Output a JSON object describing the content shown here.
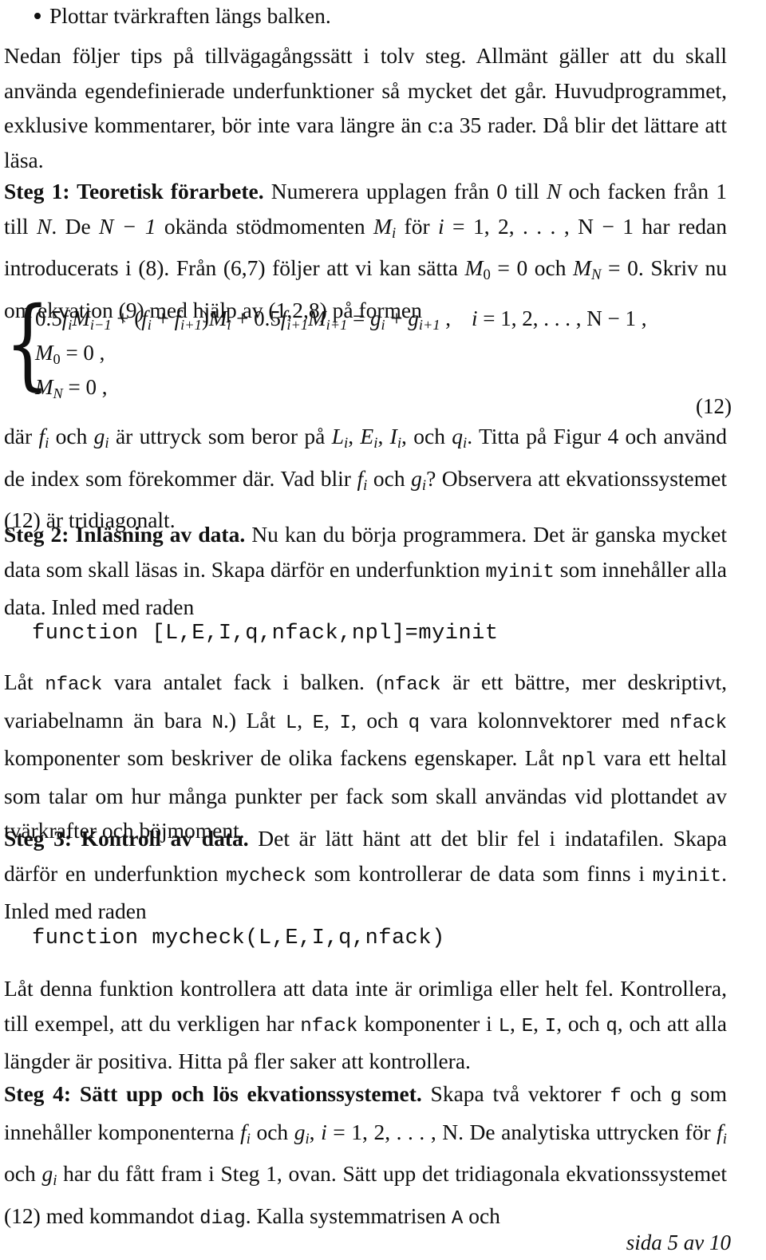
{
  "document": {
    "language": "sv",
    "footer": "sida 5 av 10"
  },
  "bullet": {
    "marker": "•",
    "text": "Plottar tvärkraften längs balken."
  },
  "intro": {
    "text": "Nedan följer tips på tillvägagångssätt i tolv steg. Allmänt gäller att du skall använda egendefinierade underfunktioner så mycket det går. Huvudprogrammet, exklusive kommentarer, bör inte vara längre än c:a 35 rader. Då blir det lättare att läsa."
  },
  "steg1": {
    "heading": "Steg 1: Teoretisk förarbete.",
    "body_part1": " Numerera upplagen från 0 till ",
    "sym_N": "N",
    "body_part2": " och facken från 1 till ",
    "body_part3": ". De ",
    "expr_N_minus_1": "N − 1",
    "body_part4": " okända stödmomenten ",
    "sym_M": "M",
    "sub_i": "i",
    "body_part5": " för ",
    "sym_i": "i",
    "expr_eq_list": " = 1, 2, . . . , N − 1",
    "body_part6": " har redan introducerats i (8). Från (6,7) följer att vi kan sätta ",
    "expr_M0": "M",
    "sub_0": "0",
    "expr_eq0": " = 0",
    "body_part7": " och ",
    "sub_N": "N",
    "body_part8": ". Skriv nu om ekvation (9) med hjälp av (1,2,8) på formen"
  },
  "equation12": {
    "tag": "(12)",
    "brace": "{",
    "line1": {
      "coef1": "0.5",
      "f1": "f",
      "f1sub": "i",
      "M1": "M",
      "M1sub": "i−1",
      "plus1": " + (",
      "f2": "f",
      "f2sub": "i",
      "plus2": " + ",
      "f3": "f",
      "f3sub": "i+1",
      "close": ")",
      "M2": "M",
      "M2sub": "i",
      "plus3": " + ",
      "coef2": "0.5",
      "f4": "f",
      "f4sub": "i+1",
      "M3": "M",
      "M3sub": "i+1",
      "eq": " = ",
      "g1": "g",
      "g1sub": "i",
      "plus4": " + ",
      "g2": "g",
      "g2sub": "i+1",
      "comma": " ,",
      "range_i": "i",
      "range_rest": " = 1, 2, . . . , N − 1 ,"
    },
    "line2": {
      "sym": "M",
      "sub": "0",
      "rest": " = 0 ,"
    },
    "line3": {
      "sym": "M",
      "sub": "N",
      "rest": " = 0 ,"
    }
  },
  "after_eq": {
    "t1": "där ",
    "f": "f",
    "fsub": "i",
    "t2": " och ",
    "g": "g",
    "gsub": "i",
    "t3": " är uttryck som beror på ",
    "L": "L",
    "Lsub": "i",
    "t4": ", ",
    "E": "E",
    "Esub": "i",
    "t5": ", ",
    "I": "I",
    "Isub": "i",
    "t6": ", och ",
    "q": "q",
    "qsub": "i",
    "t7": ". Titta på Figur 4 och använd de index som förekommer där. Vad blir ",
    "t8": " och ",
    "t9": "? Observera att ekvationssystemet (12) är tridiagonalt."
  },
  "steg2": {
    "heading": "Steg 2: Inläsning av data.",
    "body_a": " Nu kan du börja programmera. Det är ganska mycket data som skall läsas in. Skapa därför en underfunktion ",
    "code_myinit": "myinit",
    "body_b": " som innehåller alla data. Inled med raden",
    "codeline": "function [L,E,I,q,nfack,npl]=myinit",
    "body2_a": "Låt ",
    "code_nfack": "nfack",
    "body2_b": " vara antalet fack i balken. (",
    "body2_c": " är ett bättre, mer deskriptivt, variabelnamn än bara ",
    "code_N": "N",
    "body2_d": ".) Låt ",
    "code_L": "L",
    "body2_e": ", ",
    "code_E": "E",
    "body2_f": ", ",
    "code_I": "I",
    "body2_g": ", och ",
    "code_q": "q",
    "body2_h": " vara kolonnvektorer med ",
    "body2_i": " komponenter som beskriver de olika fackens egenskaper. Låt ",
    "code_npl": "npl",
    "body2_j": " vara ett heltal som talar om hur många punkter per fack som skall användas vid plottandet av tvärkrafter och böjmoment."
  },
  "steg3": {
    "heading": "Steg 3: Kontroll av data.",
    "body_a": " Det är lätt hänt att det blir fel i indatafilen. Skapa därför en underfunktion ",
    "code_mycheck": "mycheck",
    "body_b": " som kontrollerar de data som finns i ",
    "code_myinit": "myinit",
    "body_c": ". Inled med raden",
    "codeline": "function mycheck(L,E,I,q,nfack)",
    "body2_a": "Låt denna funktion kontrollera att data inte är orimliga eller helt fel. Kontrollera, till exempel, att du verkligen har ",
    "code_nfack": "nfack",
    "body2_b": " komponenter i ",
    "code_L": "L",
    "body2_c": ", ",
    "code_E": "E",
    "body2_d": ", ",
    "code_I": "I",
    "body2_e": ", och ",
    "code_q": "q",
    "body2_f": ", och att alla längder är positiva. Hitta på fler saker att kontrollera."
  },
  "steg4": {
    "heading": "Steg 4: Sätt upp och lös ekvationssystemet.",
    "body_a": " Skapa två vektorer ",
    "code_f": "f",
    "body_b": " och ",
    "code_g": "g",
    "body_c": " som innehåller komponenterna ",
    "m_f": "f",
    "m_fsub": "i",
    "body_d": " och ",
    "m_g": "g",
    "m_gsub": "i",
    "body_e": ", ",
    "m_i": "i",
    "m_range": " = 1, 2, . . . , N",
    "body_f": ". De analytiska uttrycken för ",
    "body_g": " och ",
    "body_h": " har du fått fram i Steg 1, ovan. Sätt upp det tridiagonala ekvationssystemet (12) med kommandot ",
    "code_diag": "diag",
    "body_i": ". Kalla systemmatrisen ",
    "code_A": "A",
    "body_j": " och"
  }
}
